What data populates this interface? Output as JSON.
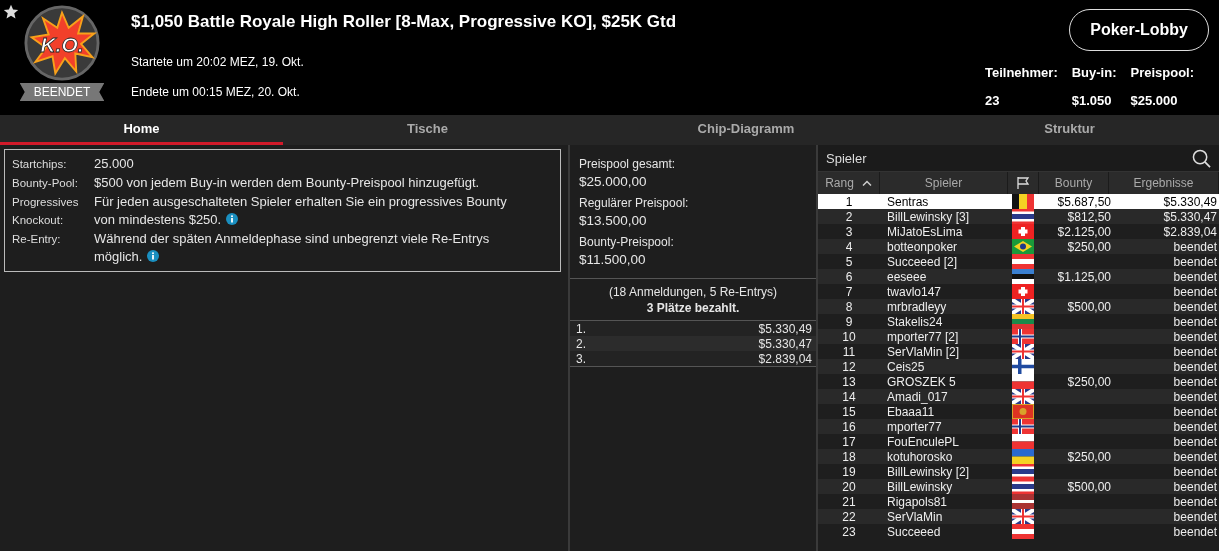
{
  "header": {
    "logo_text": "K.O.",
    "status_badge": "BEENDET",
    "title": "$1,050 Battle Royale High Roller [8-Max, Progressive KO], $25K Gtd",
    "started": "Startete um 20:02 MEZ, 19. Okt.",
    "ended": "Endete um 00:15 MEZ, 20. Okt.",
    "lobby_button": "Poker-Lobby",
    "stats": [
      {
        "label": "Teilnehmer:",
        "value": "23"
      },
      {
        "label": "Buy-in:",
        "value": "$1.050"
      },
      {
        "label": "Preispool:",
        "value": "$25.000"
      }
    ]
  },
  "tabs": [
    {
      "label": "Home",
      "selected": true
    },
    {
      "label": "Tische",
      "selected": false
    },
    {
      "label": "Chip-Diagramm",
      "selected": false
    },
    {
      "label": "Struktur",
      "selected": false
    }
  ],
  "details": [
    {
      "label": "Startchips:",
      "text": "25.000",
      "info": false
    },
    {
      "label": "Bounty-Pool:",
      "text": "$500 von jedem Buy-in werden dem Bounty-Preispool hinzugefügt.",
      "info": false
    },
    {
      "label": "Progressives Knockout:",
      "text": "Für jeden ausgeschalteten Spieler erhalten Sie ein progressives Bounty von mindestens $250.",
      "info": true
    },
    {
      "label": "Re-Entry:",
      "text": "Während der späten Anmeldephase sind unbegrenzt viele Re-Entrys möglich.",
      "info": true
    }
  ],
  "prize_pool": {
    "items": [
      {
        "label": "Preispool gesamt:",
        "value": "$25.000,00"
      },
      {
        "label": "Regulärer Preispool:",
        "value": "$13.500,00"
      },
      {
        "label": "Bounty-Preispool:",
        "value": "$11.500,00"
      }
    ],
    "entries": "(18 Anmeldungen, 5 Re-Entrys)",
    "paid": "3 Plätze bezahlt.",
    "payouts": [
      {
        "place": "1.",
        "amount": "$5.330,49"
      },
      {
        "place": "2.",
        "amount": "$5.330,47"
      },
      {
        "place": "3.",
        "amount": "$2.839,04"
      }
    ]
  },
  "players": {
    "search_placeholder": "Spieler",
    "columns": [
      "Rang",
      "Spieler",
      "Bounty",
      "Ergebnisse"
    ],
    "rows": [
      {
        "rank": "1",
        "name": "Sentras",
        "kind": "be",
        "bounty": "$5.687,50",
        "result": "$5.330,49",
        "selected": true
      },
      {
        "rank": "2",
        "name": "BillLewinsky [3]",
        "kind": "th",
        "bounty": "$812,50",
        "result": "$5.330,47",
        "selected": false
      },
      {
        "rank": "3",
        "name": "MiJatoEsLima",
        "kind": "ch",
        "bounty": "$2.125,00",
        "result": "$2.839,04",
        "selected": false
      },
      {
        "rank": "4",
        "name": "botteonpoker",
        "kind": "br",
        "bounty": "$250,00",
        "result": "beendet",
        "selected": false
      },
      {
        "rank": "5",
        "name": "Succeeed [2]",
        "kind": "at",
        "bounty": "",
        "result": "beendet",
        "selected": false
      },
      {
        "rank": "6",
        "name": "eeseee",
        "kind": "ee",
        "bounty": "$1.125,00",
        "result": "beendet",
        "selected": false
      },
      {
        "rank": "7",
        "name": "twavlo147",
        "kind": "ch",
        "bounty": "",
        "result": "beendet",
        "selected": false
      },
      {
        "rank": "8",
        "name": "mrbradleyy",
        "kind": "gb",
        "bounty": "$500,00",
        "result": "beendet",
        "selected": false
      },
      {
        "rank": "9",
        "name": "Stakelis24",
        "kind": "lt",
        "bounty": "",
        "result": "beendet",
        "selected": false
      },
      {
        "rank": "10",
        "name": "mporter77 [2]",
        "kind": "no",
        "bounty": "",
        "result": "beendet",
        "selected": false
      },
      {
        "rank": "11",
        "name": "SerVlaMin [2]",
        "kind": "gb",
        "bounty": "",
        "result": "beendet",
        "selected": false
      },
      {
        "rank": "12",
        "name": "Ceis25",
        "kind": "fi",
        "bounty": "",
        "result": "beendet",
        "selected": false
      },
      {
        "rank": "13",
        "name": "GROSZEK 5",
        "kind": "pl",
        "bounty": "$250,00",
        "result": "beendet",
        "selected": false
      },
      {
        "rank": "14",
        "name": "Amadi_017",
        "kind": "gb",
        "bounty": "",
        "result": "beendet",
        "selected": false
      },
      {
        "rank": "15",
        "name": "Ebaaa11",
        "kind": "me",
        "bounty": "",
        "result": "beendet",
        "selected": false
      },
      {
        "rank": "16",
        "name": "mporter77",
        "kind": "no",
        "bounty": "",
        "result": "beendet",
        "selected": false
      },
      {
        "rank": "17",
        "name": "FouEnculePL",
        "kind": "pl",
        "bounty": "",
        "result": "beendet",
        "selected": false
      },
      {
        "rank": "18",
        "name": "kotuhorosko",
        "kind": "ua",
        "bounty": "$250,00",
        "result": "beendet",
        "selected": false
      },
      {
        "rank": "19",
        "name": "BillLewinsky [2]",
        "kind": "th",
        "bounty": "",
        "result": "beendet",
        "selected": false
      },
      {
        "rank": "20",
        "name": "BillLewinsky",
        "kind": "th",
        "bounty": "$500,00",
        "result": "beendet",
        "selected": false
      },
      {
        "rank": "21",
        "name": "Rigapols81",
        "kind": "lv",
        "bounty": "",
        "result": "beendet",
        "selected": false
      },
      {
        "rank": "22",
        "name": "SerVlaMin",
        "kind": "gb",
        "bounty": "",
        "result": "beendet",
        "selected": false
      },
      {
        "rank": "23",
        "name": "Succeeed",
        "kind": "at",
        "bounty": "",
        "result": "beendet",
        "selected": false
      }
    ]
  }
}
